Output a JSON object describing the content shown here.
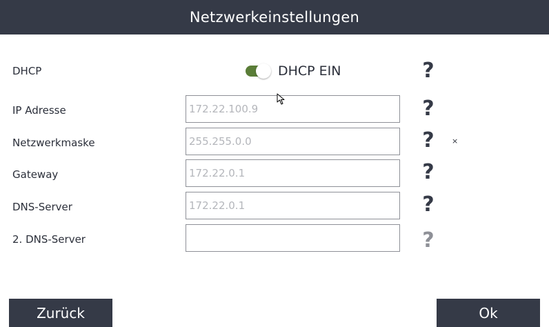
{
  "window": {
    "title": "Netzwerkeinstellungen"
  },
  "dhcp": {
    "label": "DHCP",
    "toggle_text": "DHCP EIN",
    "enabled": true,
    "accent": "#5a7d37"
  },
  "fields": [
    {
      "label": "IP Adresse",
      "placeholder": "172.22.100.9"
    },
    {
      "label": "Netzwerkmaske",
      "placeholder": "255.255.0.0"
    },
    {
      "label": "Gateway",
      "placeholder": "172.22.0.1"
    },
    {
      "label": "DNS-Server",
      "placeholder": "172.22.0.1"
    },
    {
      "label": "2. DNS-Server",
      "placeholder": ""
    }
  ],
  "help": {
    "symbol": "?"
  },
  "close": {
    "symbol": "×"
  },
  "buttons": {
    "back": "Zurück",
    "ok": "Ok"
  },
  "colors": {
    "header": "#353a47",
    "button": "#353a47",
    "help_disabled": "#8e9097"
  }
}
